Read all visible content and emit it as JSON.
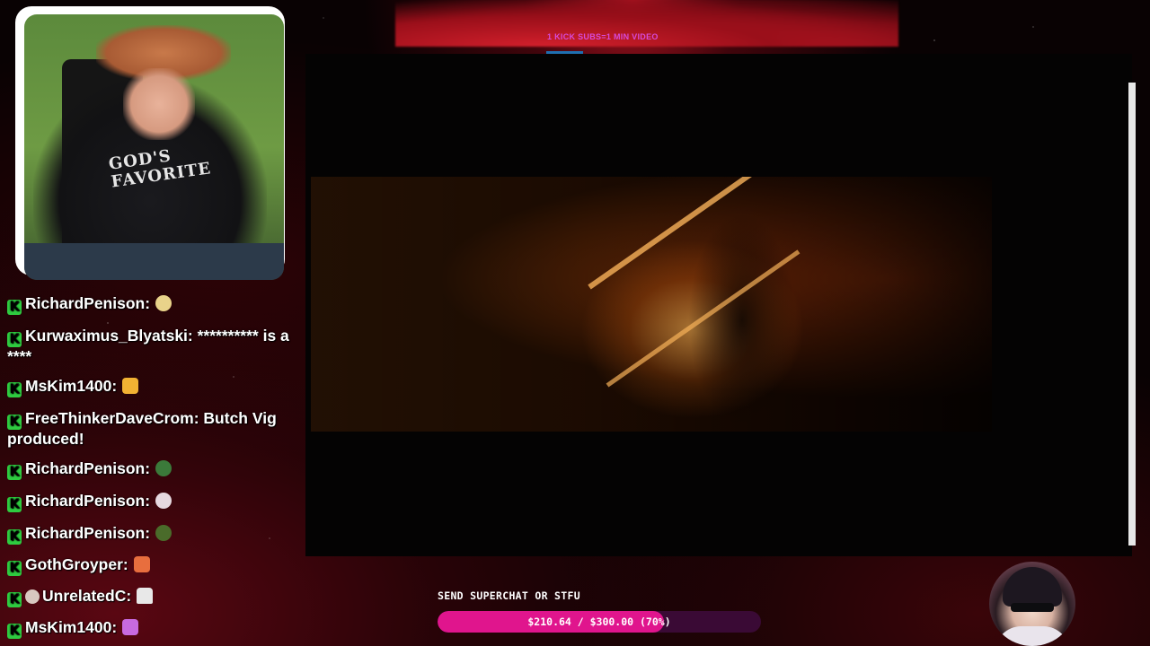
{
  "banner": {
    "text": "1 KICK SUBS=1 MIN VIDEO"
  },
  "webcam": {
    "shirt_text": "GOD'S\nFAVORITE"
  },
  "chat": {
    "messages": [
      {
        "user": "RichardPenison",
        "text": "",
        "emote": "emote-face",
        "emote_color": "#e9d38a"
      },
      {
        "user": "Kurwaximus_Blyatski",
        "text": "********** is a ****",
        "emote": "",
        "emote_color": ""
      },
      {
        "user": "MsKim1400",
        "text": "",
        "emote": "emote-cat",
        "emote_color": "#f2b233"
      },
      {
        "user": "FreeThinkerDaveCrom",
        "text": "Butch Vig produced!",
        "emote": "",
        "emote_color": ""
      },
      {
        "user": "RichardPenison",
        "text": "",
        "emote": "emote-frog",
        "emote_color": "#3b7a3a"
      },
      {
        "user": "RichardPenison",
        "text": "",
        "emote": "emote-rabbit",
        "emote_color": "#e6d9e0"
      },
      {
        "user": "RichardPenison",
        "text": "",
        "emote": "emote-turtle",
        "emote_color": "#4a6b2a"
      },
      {
        "user": "GothGroyper",
        "text": "",
        "emote": "emote-pig",
        "emote_color": "#e86e3e"
      },
      {
        "user": "UnrelatedC",
        "text": "",
        "emote": "emote-ghost",
        "emote_color": "#e8e8e8",
        "prefix_icon": "avatar-icon"
      },
      {
        "user": "MsKim1400",
        "text": "",
        "emote": "emote-bow",
        "emote_color": "#c86ae0"
      }
    ]
  },
  "goal": {
    "label": "SEND SUPERCHAT OR STFU",
    "text": "$210.64 / $300.00 (70%)",
    "progress": 0.7
  },
  "colors": {
    "accent_pink": "#e0158d",
    "kick_green": "#2ecc40",
    "banner_text": "#d64ad8"
  }
}
